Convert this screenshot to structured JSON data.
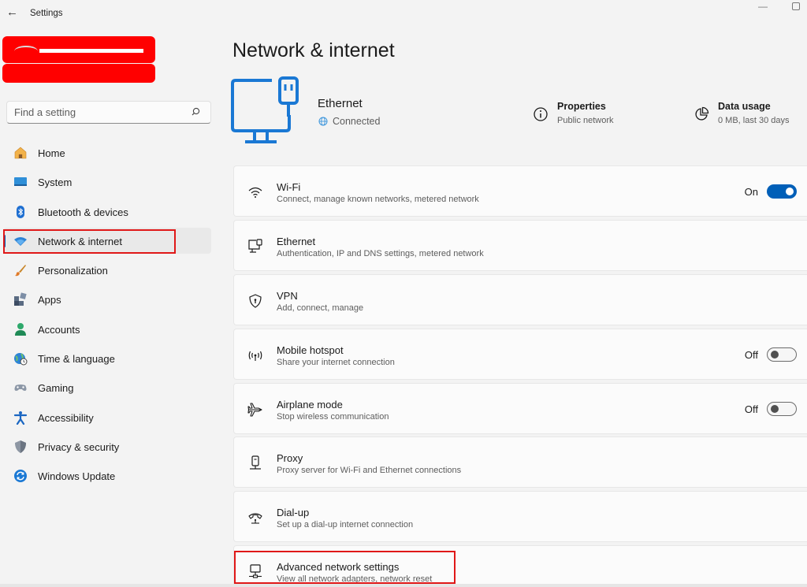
{
  "titlebar": {
    "app_title": "Settings"
  },
  "search": {
    "placeholder": "Find a setting"
  },
  "nav": {
    "items": [
      {
        "label": "Home"
      },
      {
        "label": "System"
      },
      {
        "label": "Bluetooth & devices"
      },
      {
        "label": "Network & internet"
      },
      {
        "label": "Personalization"
      },
      {
        "label": "Apps"
      },
      {
        "label": "Accounts"
      },
      {
        "label": "Time & language"
      },
      {
        "label": "Gaming"
      },
      {
        "label": "Accessibility"
      },
      {
        "label": "Privacy & security"
      },
      {
        "label": "Windows Update"
      }
    ]
  },
  "page": {
    "title": "Network & internet"
  },
  "hero": {
    "name": "Ethernet",
    "status": "Connected"
  },
  "meta": {
    "properties": {
      "title": "Properties",
      "sub": "Public network"
    },
    "data_usage": {
      "title": "Data usage",
      "sub": "0 MB, last 30 days"
    }
  },
  "cards": [
    {
      "title": "Wi-Fi",
      "sub": "Connect, manage known networks, metered network",
      "state": "On"
    },
    {
      "title": "Ethernet",
      "sub": "Authentication, IP and DNS settings, metered network"
    },
    {
      "title": "VPN",
      "sub": "Add, connect, manage"
    },
    {
      "title": "Mobile hotspot",
      "sub": "Share your internet connection",
      "state": "Off"
    },
    {
      "title": "Airplane mode",
      "sub": "Stop wireless communication",
      "state": "Off"
    },
    {
      "title": "Proxy",
      "sub": "Proxy server for Wi-Fi and Ethernet connections"
    },
    {
      "title": "Dial-up",
      "sub": "Set up a dial-up internet connection"
    },
    {
      "title": "Advanced network settings",
      "sub": "View all network adapters, network reset"
    }
  ],
  "colors": {
    "accent": "#005fb8",
    "highlight": "#e01818",
    "redaction": "#ff0000"
  }
}
